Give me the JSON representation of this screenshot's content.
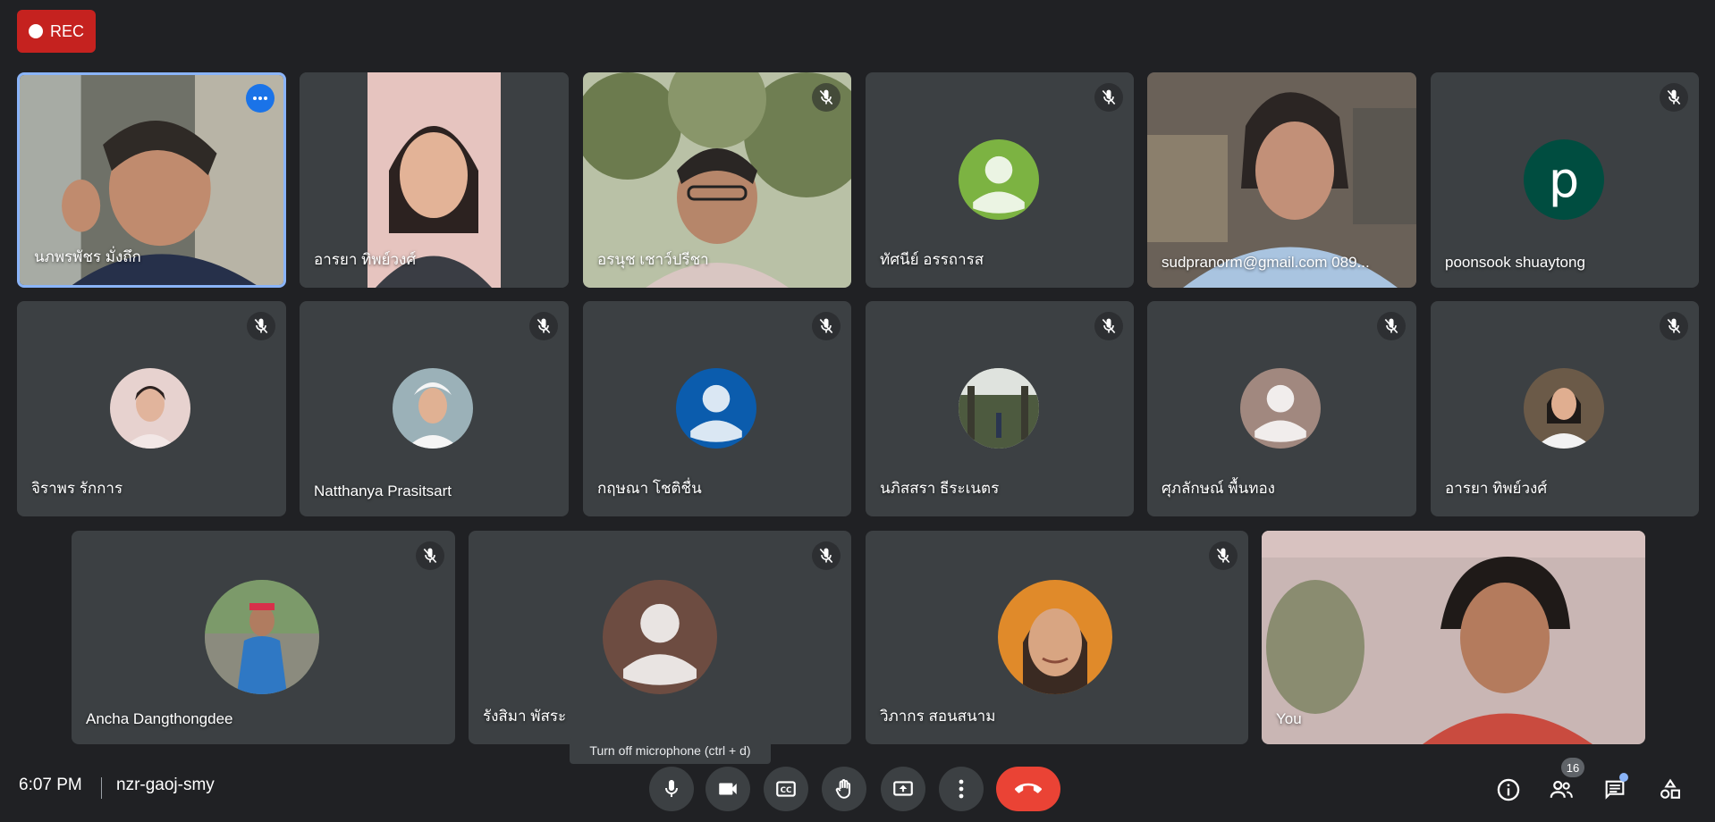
{
  "recording": {
    "label": "REC"
  },
  "participants": {
    "row1": [
      {
        "name": "นภพรพัชร มั่งถึก"
      },
      {
        "name": "อารยา ทิพย์วงศ์"
      },
      {
        "name": "อรนุช เชาว์ปรีชา"
      },
      {
        "name": "ทัศนีย์ อรรถารส"
      },
      {
        "name": "sudpranorm@gmail.com 089..."
      },
      {
        "name": "poonsook shuaytong",
        "avatar_letter": "p"
      }
    ],
    "row2": [
      {
        "name": "จิราพร รักการ"
      },
      {
        "name": "Natthanya Prasitsart"
      },
      {
        "name": "กฤษณา โชติชื่น"
      },
      {
        "name": "นภิสสรา ธีระเนตร"
      },
      {
        "name": "ศุภลักษณ์ พื้นทอง"
      },
      {
        "name": "อารยา ทิพย์วงศ์"
      }
    ],
    "row3": [
      {
        "name": "Ancha Dangthongdee"
      },
      {
        "name": "รังสิมา พัสระ"
      },
      {
        "name": "วิภากร สอนสนาม"
      },
      {
        "name": "You"
      }
    ]
  },
  "tooltip": "Turn off microphone (ctrl + d)",
  "footer": {
    "time": "6:07 PM",
    "meeting_code": "nzr-gaoj-smy",
    "people_count": "16"
  },
  "colors": {
    "accent": "#8ab4f8",
    "end_call": "#ea4335",
    "rec": "#c5221f",
    "tile": "#3c4043"
  }
}
